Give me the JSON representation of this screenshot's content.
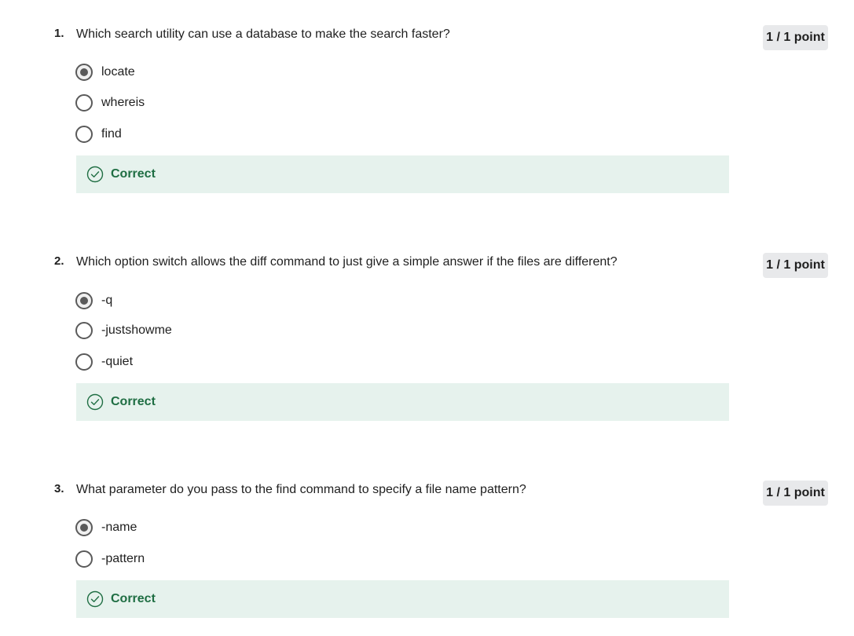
{
  "colors": {
    "correct_bg": "#e6f2ed",
    "correct_text": "#1f6e43",
    "badge_bg": "#e8e9eb",
    "radio": "#5a5a5a"
  },
  "questions": [
    {
      "number": "1.",
      "text": "Which search utility can use a database to make the search faster?",
      "points": "1 / 1 point",
      "options": [
        {
          "label": "locate",
          "selected": true
        },
        {
          "label": "whereis",
          "selected": false
        },
        {
          "label": "find",
          "selected": false
        }
      ],
      "feedback": {
        "label": "Correct",
        "icon": "check-circle-icon"
      }
    },
    {
      "number": "2.",
      "text": "Which option switch allows the diff command to just give a simple answer if the files are different?",
      "points": "1 / 1 point",
      "options": [
        {
          "label": "-q",
          "selected": true
        },
        {
          "label": "-justshowme",
          "selected": false
        },
        {
          "label": "-quiet",
          "selected": false
        }
      ],
      "feedback": {
        "label": "Correct",
        "icon": "check-circle-icon"
      }
    },
    {
      "number": "3.",
      "text": "What parameter do you pass to the find command to specify a file name pattern?",
      "points": "1 / 1 point",
      "options": [
        {
          "label": "-name",
          "selected": true
        },
        {
          "label": "-pattern",
          "selected": false
        }
      ],
      "feedback": {
        "label": "Correct",
        "icon": "check-circle-icon"
      }
    }
  ]
}
